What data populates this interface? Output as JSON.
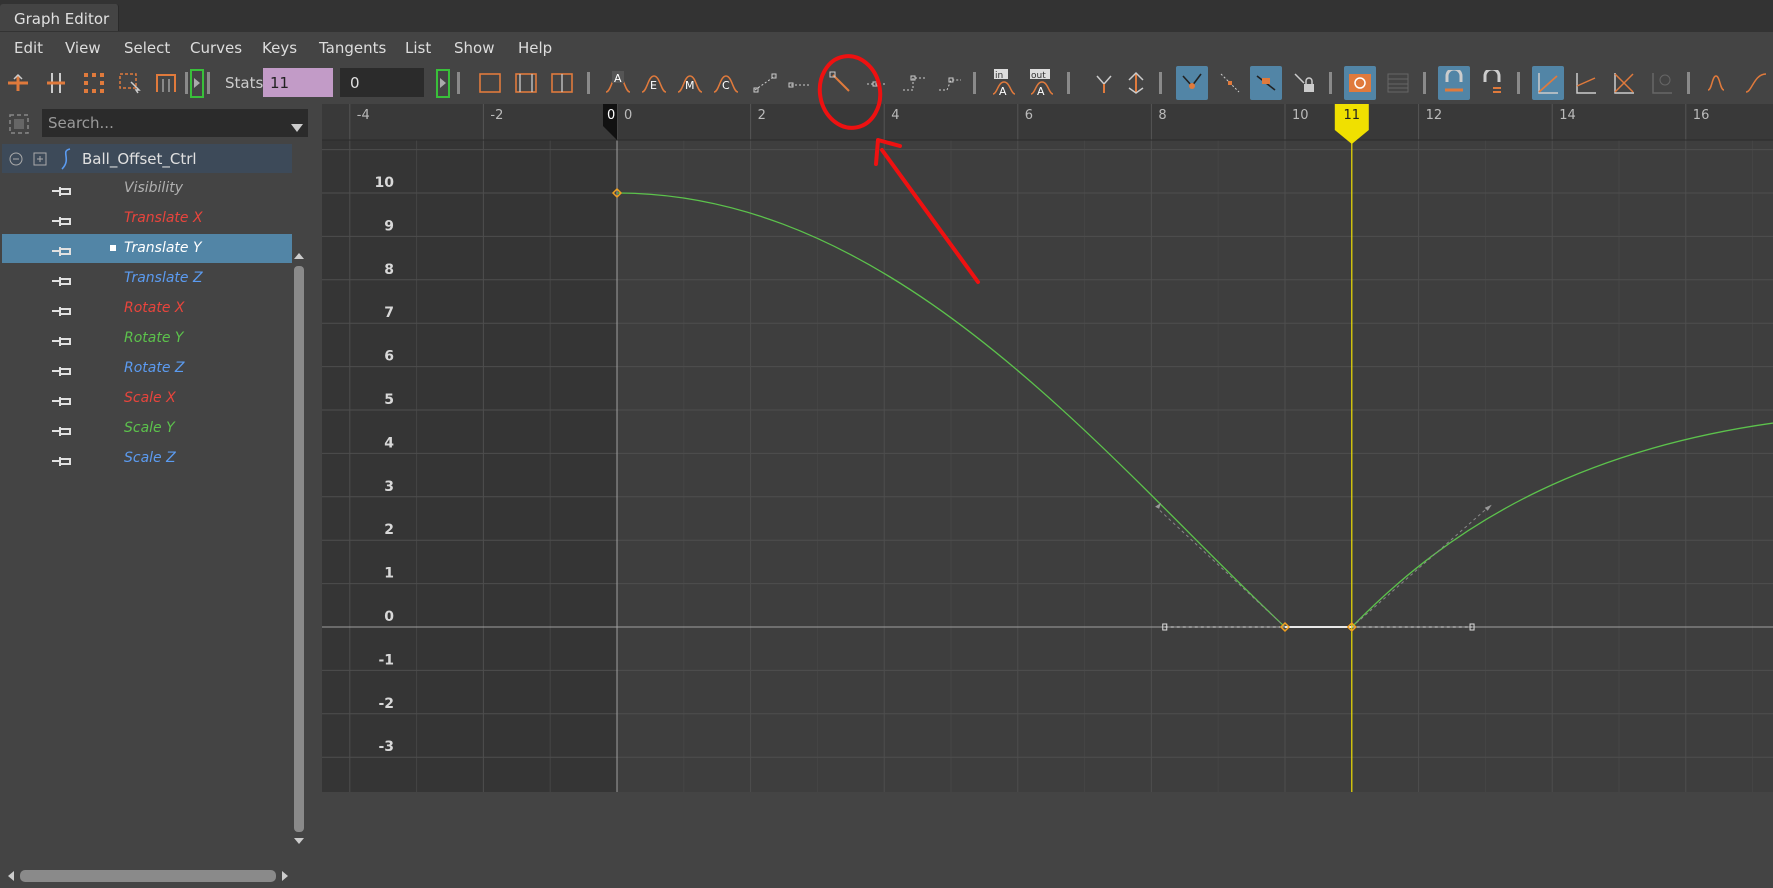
{
  "window": {
    "tab_title": "Graph Editor"
  },
  "menu": [
    "Edit",
    "View",
    "Select",
    "Curves",
    "Keys",
    "Tangents",
    "List",
    "Show",
    "Help"
  ],
  "toolbar": {
    "stats_label": "Stats",
    "stats_value": "11",
    "stats_value2": "0",
    "icons": [
      "move-key-icon",
      "insert-key-icon",
      "lattice-deform-icon",
      "region-select-icon",
      "retime-icon",
      "auto-tangent-icon",
      "spline-tangent-icon",
      "clamped-tangent-icon",
      "linear-tangent-icon",
      "flat-tangent-icon",
      "step-tangent-icon",
      "plateau-tangent-icon",
      "buffer-curve-icon",
      "break-tangent-icon",
      "lock-tangent-icon",
      "normalize-icon",
      "stacked-view-icon",
      "time-snap-icon",
      "value-snap-icon",
      "pre-infinity-icon",
      "post-infinity-icon"
    ],
    "annotation": "circled-linear-tangent-button"
  },
  "outliner": {
    "search_placeholder": "Search...",
    "node": "Ball_Offset_Ctrl",
    "attributes": [
      {
        "label": "Visibility",
        "color": "#b0b0b0",
        "selected": false
      },
      {
        "label": "Translate X",
        "color": "#e8453c",
        "selected": false
      },
      {
        "label": "Translate Y",
        "color": "#ffffff",
        "selected": true
      },
      {
        "label": "Translate Z",
        "color": "#5b9bf0",
        "selected": false
      },
      {
        "label": "Rotate X",
        "color": "#e8453c",
        "selected": false
      },
      {
        "label": "Rotate Y",
        "color": "#5cc24c",
        "selected": false
      },
      {
        "label": "Rotate Z",
        "color": "#5b9bf0",
        "selected": false
      },
      {
        "label": "Scale X",
        "color": "#e8453c",
        "selected": false
      },
      {
        "label": "Scale Y",
        "color": "#5cc24c",
        "selected": false
      },
      {
        "label": "Scale Z",
        "color": "#5b9bf0",
        "selected": false
      }
    ]
  },
  "graph": {
    "frame_ticks": [
      "-4",
      "-2",
      "0",
      "2",
      "4",
      "6",
      "8",
      "10",
      "12",
      "14",
      "16"
    ],
    "value_ticks": [
      "10",
      "9",
      "8",
      "7",
      "6",
      "5",
      "4",
      "3",
      "2",
      "1",
      "0",
      "-1",
      "-2",
      "-3"
    ],
    "current_frame": "11",
    "start_marker": "0",
    "curve_color": "#5cc24c",
    "playhead_color": "#f0e000",
    "keys": [
      {
        "frame": 0,
        "value": 10
      },
      {
        "frame": 10,
        "value": 0
      },
      {
        "frame": 11,
        "value": 0
      }
    ]
  }
}
